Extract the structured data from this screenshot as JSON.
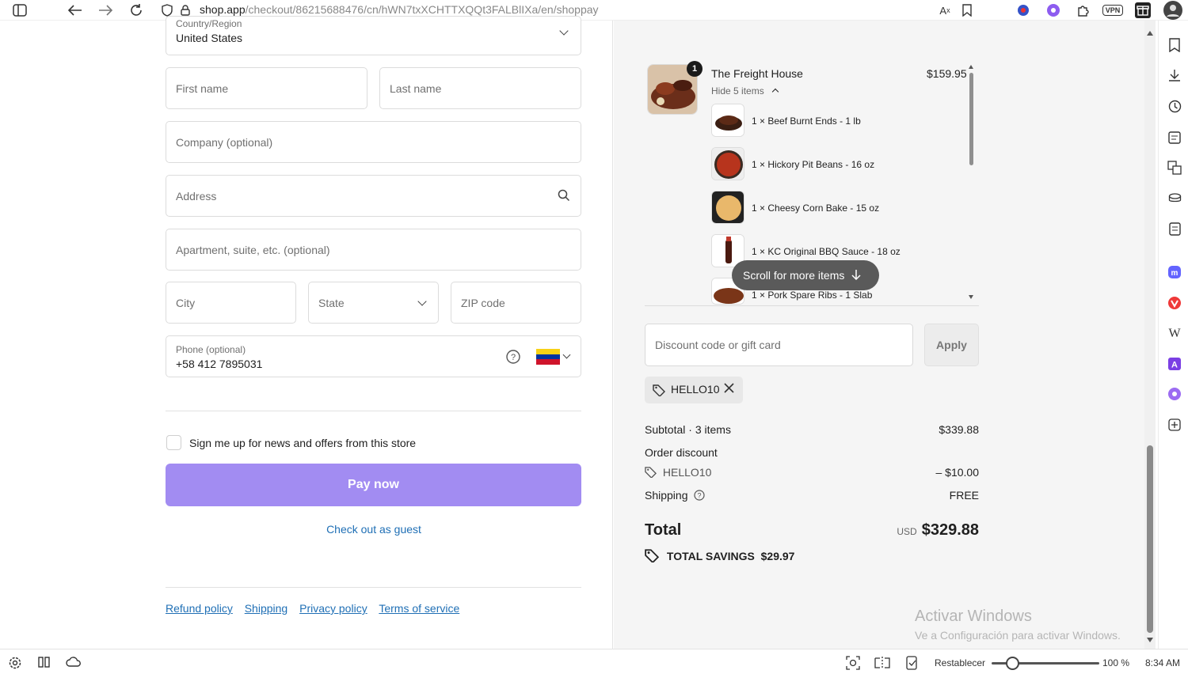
{
  "browser": {
    "url_main": "shop.app",
    "url_rest": "/checkout/86215688476/cn/hWN7txXCHTTXQQt3FALBlIXa/en/shoppay",
    "vpn_label": "VPN"
  },
  "form": {
    "country": {
      "label": "Country/Region",
      "value": "United States"
    },
    "first_name_placeholder": "First name",
    "last_name_placeholder": "Last name",
    "company_placeholder": "Company (optional)",
    "address_placeholder": "Address",
    "apartment_placeholder": "Apartment, suite, etc. (optional)",
    "city_placeholder": "City",
    "state_placeholder": "State",
    "zip_placeholder": "ZIP code",
    "phone": {
      "label": "Phone (optional)",
      "value": "+58 412 7895031"
    },
    "newsletter_label": "Sign me up for news and offers from this store",
    "pay_label": "Pay now",
    "guest_link": "Check out as guest",
    "policies": [
      "Refund policy",
      "Shipping",
      "Privacy policy",
      "Terms of service"
    ]
  },
  "summary": {
    "product": {
      "badge": "1",
      "name": "The Freight House",
      "price": "$159.95",
      "toggle": "Hide 5 items"
    },
    "items": [
      "1 × Beef Burnt Ends - 1 lb",
      "1 × Hickory Pit Beans - 16 oz",
      "1 × Cheesy Corn Bake - 15 oz",
      "1 × KC Original BBQ Sauce - 18 oz",
      "1 × Pork Spare Ribs - 1 Slab"
    ],
    "scroll_hint": "Scroll for more items",
    "discount_placeholder": "Discount code or gift card",
    "apply_label": "Apply",
    "code": "HELLO10",
    "subtotal_label": "Subtotal · 3 items",
    "subtotal_value": "$339.88",
    "order_discount_label": "Order discount",
    "discount_code": "HELLO10",
    "discount_value": "– $10.00",
    "shipping_label": "Shipping",
    "shipping_value": "FREE",
    "total_label": "Total",
    "currency": "USD",
    "total_value": "$329.88",
    "savings": "TOTAL SAVINGS  $29.97"
  },
  "watermark": {
    "line1": "Activar Windows",
    "line2": "Ve a Configuración para activar Windows."
  },
  "statusbar": {
    "reset_label": "Restablecer",
    "zoom": "100 %",
    "time": "8:34 AM"
  },
  "colors": {
    "pay_button": "#a28cf2",
    "link": "#1f6fb5"
  }
}
